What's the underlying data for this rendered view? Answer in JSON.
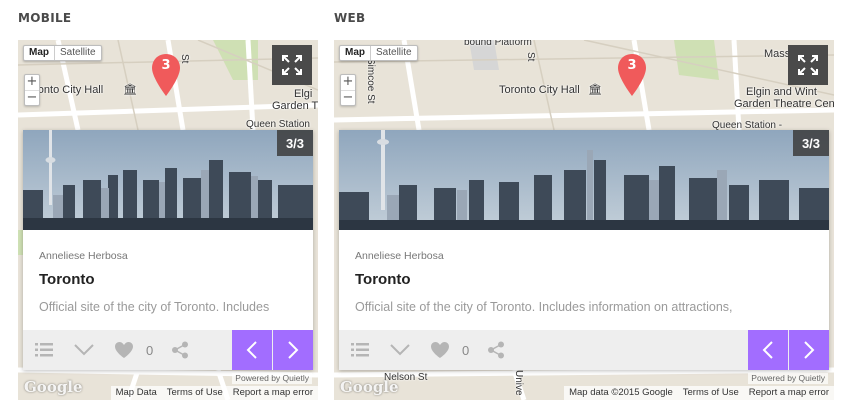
{
  "sections": {
    "mobile_label": "MOBILE",
    "web_label": "WEB"
  },
  "map": {
    "type_map": "Map",
    "type_satellite": "Satellite",
    "zoom_in": "+",
    "zoom_out": "−",
    "marker_count": "3",
    "google": "Google",
    "labels_mobile": {
      "city_hall": "oronto City Hall",
      "elgin_1": "Elgi",
      "elgin_2": "Garden Th",
      "queen_station": "Queen Station",
      "st": "St"
    },
    "labels_web": {
      "top": "bound Platform",
      "simcoe": "Simcoe St",
      "st1": "St",
      "city_hall": "Toronto City Hall",
      "massey": "Masse",
      "elgin_1": "Elgin and Wint",
      "elgin_2": "Garden Theatre Cent",
      "queen_station": "Queen Station -",
      "nelson": "Nelson St",
      "univ": "Unive"
    }
  },
  "card": {
    "counter": "3/3",
    "author": "Anneliese Herbosa",
    "title": "Toronto",
    "desc_mobile": "Official site of the city of Toronto. Includes",
    "desc_web": "Official site of the city of Toronto. Includes information on attractions,",
    "like_count": "0"
  },
  "footer": {
    "powered": "Powered by Quietly",
    "map_data_mobile": "Map Data",
    "map_data_web": "Map data ©2015 Google",
    "terms": "Terms of Use",
    "report": "Report a map error"
  },
  "colors": {
    "accent": "#a26dff",
    "marker": "#f05a5b",
    "map_bg": "#e8e3d8",
    "park": "#cfe0b4"
  },
  "icons": [
    "expand-icon",
    "map-marker-icon",
    "list-icon",
    "chevron-down-icon",
    "heart-icon",
    "share-icon",
    "chevron-left-icon",
    "chevron-right-icon",
    "city-hall-icon"
  ]
}
